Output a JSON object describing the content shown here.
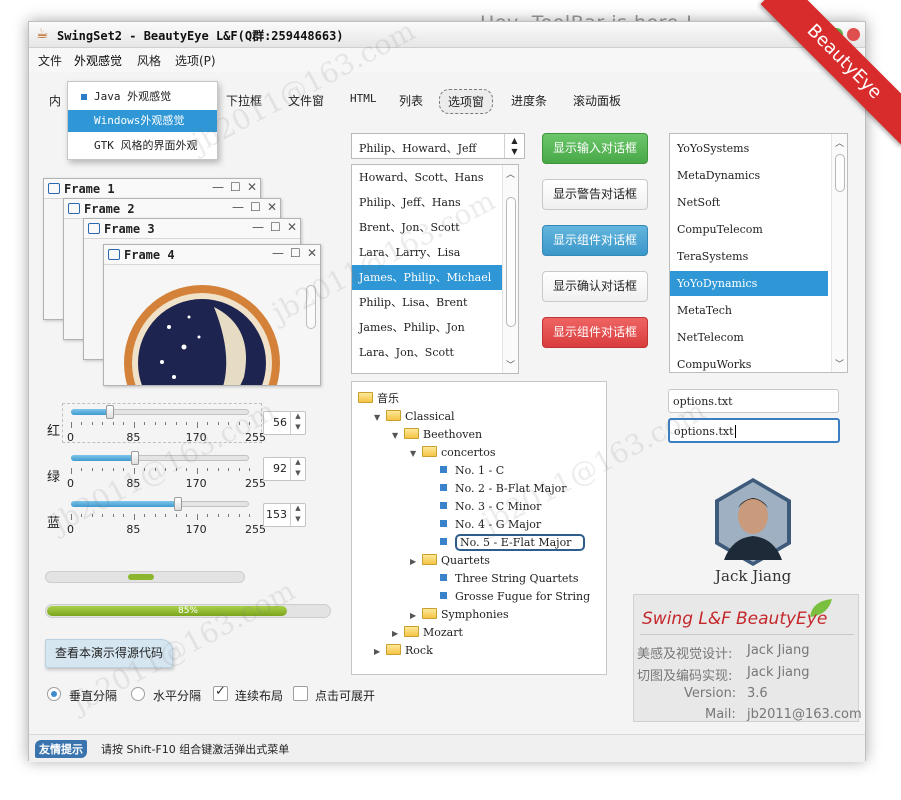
{
  "window": {
    "title": "SwingSet2 - BeautyEye L&F(Q群:259448663)"
  },
  "annotation": {
    "toolbar_hint": "Hey, ToolBar is here !",
    "ribbon": "BeautyEye"
  },
  "menubar": {
    "items": [
      "文件",
      "外观感觉",
      "风格",
      "选项(P)"
    ]
  },
  "dropdown": {
    "items": [
      "Java 外观感觉",
      "Windows外观感觉",
      "GTK 风格的界面外观"
    ]
  },
  "toolbar": {
    "partial_first": "内",
    "items": [
      "下拉框",
      "文件窗",
      "HTML",
      "列表",
      "选项窗",
      "进度条",
      "滚动面板"
    ],
    "selected": "选项窗"
  },
  "internal_frames": [
    "Frame 1",
    "Frame 2",
    "Frame 3",
    "Frame 4"
  ],
  "combo": {
    "value": "Philip、Howard、Jeff"
  },
  "names_list": {
    "items": [
      "Howard、Scott、Hans",
      "Philip、Jeff、Hans",
      "Brent、Jon、Scott",
      "Lara、Larry、Lisa",
      "James、Philip、Michael",
      "Philip、Lisa、Brent",
      "James、Philip、Jon",
      "Lara、Jon、Scott"
    ],
    "selected_index": 4
  },
  "buttons": [
    "显示输入对话框",
    "显示警告对话框",
    "显示组件对话框",
    "显示确认对话框",
    "显示组件对话框"
  ],
  "company_list": {
    "items": [
      "YoYoSystems",
      "MetaDynamics",
      "NetSoft",
      "CompuTelecom",
      "TeraSystems",
      "YoYoDynamics",
      "MetaTech",
      "NetTelecom",
      "CompuWorks"
    ],
    "selected_index": 5
  },
  "text_fields": [
    "options.txt",
    "options.txt"
  ],
  "tree": {
    "nodes": [
      {
        "label": "音乐",
        "kind": "folder",
        "level": 0,
        "expanded": true
      },
      {
        "label": "Classical",
        "kind": "folder",
        "level": 1,
        "expanded": true
      },
      {
        "label": "Beethoven",
        "kind": "folder",
        "level": 2,
        "expanded": true
      },
      {
        "label": "concertos",
        "kind": "folder",
        "level": 3,
        "expanded": true
      },
      {
        "label": "No. 1 - C",
        "kind": "leaf",
        "level": 4
      },
      {
        "label": "No. 2 - B-Flat Major",
        "kind": "leaf",
        "level": 4
      },
      {
        "label": "No. 3 - C Minor",
        "kind": "leaf",
        "level": 4
      },
      {
        "label": "No. 4 - G Major",
        "kind": "leaf",
        "level": 4
      },
      {
        "label": "No. 5 - E-Flat Major",
        "kind": "leaf",
        "level": 4,
        "editing": true
      },
      {
        "label": "Quartets",
        "kind": "folder",
        "level": 3,
        "expanded": false
      },
      {
        "label": "Three String Quartets",
        "kind": "leaf",
        "level": 4
      },
      {
        "label": "Grosse Fugue for String",
        "kind": "leaf",
        "level": 4
      },
      {
        "label": "Symphonies",
        "kind": "folder",
        "level": 3,
        "expanded": false
      },
      {
        "label": "Mozart",
        "kind": "folder",
        "level": 2,
        "expanded": false
      },
      {
        "label": "Rock",
        "kind": "folder",
        "level": 1,
        "expanded": false
      }
    ]
  },
  "sliders": [
    {
      "label": "红",
      "value": 56,
      "fraction": 0.22
    },
    {
      "label": "绿",
      "value": 92,
      "fraction": 0.36
    },
    {
      "label": "蓝",
      "value": 153,
      "fraction": 0.6
    }
  ],
  "slider_ticks": [
    "0",
    "85",
    "170",
    "255"
  ],
  "progress": {
    "value_text": "85%",
    "fraction": 0.85
  },
  "source_button": "查看本演示得源代码",
  "options": {
    "radio_vertical": "垂直分隔",
    "radio_horizontal": "水平分隔",
    "check_continuous": "连续布局",
    "check_expand": "点击可展开"
  },
  "avatar_name": "Jack Jiang",
  "info": {
    "brand_left": "Swing L&F",
    "brand_right": "BeautyEye",
    "designer_label": "美感及视觉设计:",
    "designer": "Jack Jiang",
    "coder_label": "切图及编码实现:",
    "coder": "Jack Jiang",
    "version_label": "Version:",
    "version": "3.6",
    "mail_label": "Mail:",
    "mail": "jb2011@163.com"
  },
  "status": {
    "badge": "友情提示",
    "text": "请按 Shift-F10 组合键激活弹出式菜单"
  },
  "watermark": "jb2011@163.com",
  "colors": {
    "accent": "#2f97d6",
    "green": "#48a847",
    "red": "#d93e3e",
    "ribbon": "#d92b2b"
  }
}
